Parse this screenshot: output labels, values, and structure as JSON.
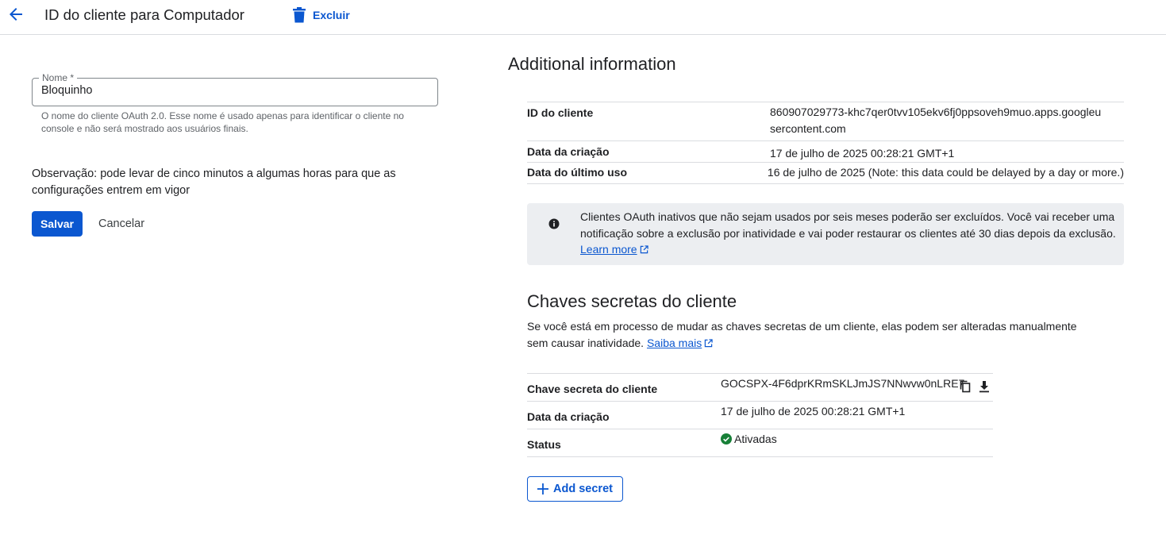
{
  "header": {
    "back_icon": "arrow-back-icon",
    "title": "ID do cliente para Computador",
    "delete_icon": "trash-icon",
    "delete_label": "Excluir"
  },
  "form": {
    "name_label": "Nome *",
    "name_value": "Bloquinho",
    "name_hint": "O nome do cliente OAuth 2.0. Esse nome é usado apenas para identificar o cliente no console e não será mostrado aos usuários finais.",
    "note": "Observação: pode levar de cinco minutos a algumas horas para que as configurações entrem em vigor",
    "save_label": "Salvar",
    "cancel_label": "Cancelar"
  },
  "additional_info": {
    "title": "Additional information",
    "rows": [
      {
        "label": "ID do cliente",
        "value": "860907029773-khc7qer0tvv105ekv6fj0ppsoveh9muo.apps.googleusercontent.com"
      },
      {
        "label": "Data da criação",
        "value": "17 de julho de 2025 00:28:21 GMT+1"
      },
      {
        "label": "Data do último uso",
        "value": "16 de julho de 2025 (Note: this data could be delayed by a day or more.)"
      }
    ]
  },
  "notice": {
    "icon": "info-icon",
    "text": "Clientes OAuth inativos que não sejam usados por seis meses poderão ser excluídos. Você vai receber uma notificação sobre a exclusão por inatividade e vai poder restaurar os clientes até 30 dias depois da exclusão.",
    "link": "Learn more"
  },
  "secrets": {
    "title": "Chaves secretas do cliente",
    "description": "Se você está em processo de mudar as chaves secretas de um cliente, elas podem ser alteradas manualmente sem causar inatividade.",
    "link": "Saiba mais",
    "rows": [
      {
        "label": "Chave secreta do cliente",
        "value": "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"
      },
      {
        "label": "Data da criação",
        "value": "17 de julho de 2025 00:28:21 GMT+1"
      },
      {
        "label": "Status",
        "value": "Ativadas"
      }
    ],
    "copy_icon": "copy-icon",
    "download_icon": "download-icon",
    "status_icon": "check-circle-icon",
    "add_label": "Add secret"
  },
  "colors": {
    "accent": "#0b57d0",
    "status_green": "#188038",
    "notice_bg": "#eceef1"
  }
}
